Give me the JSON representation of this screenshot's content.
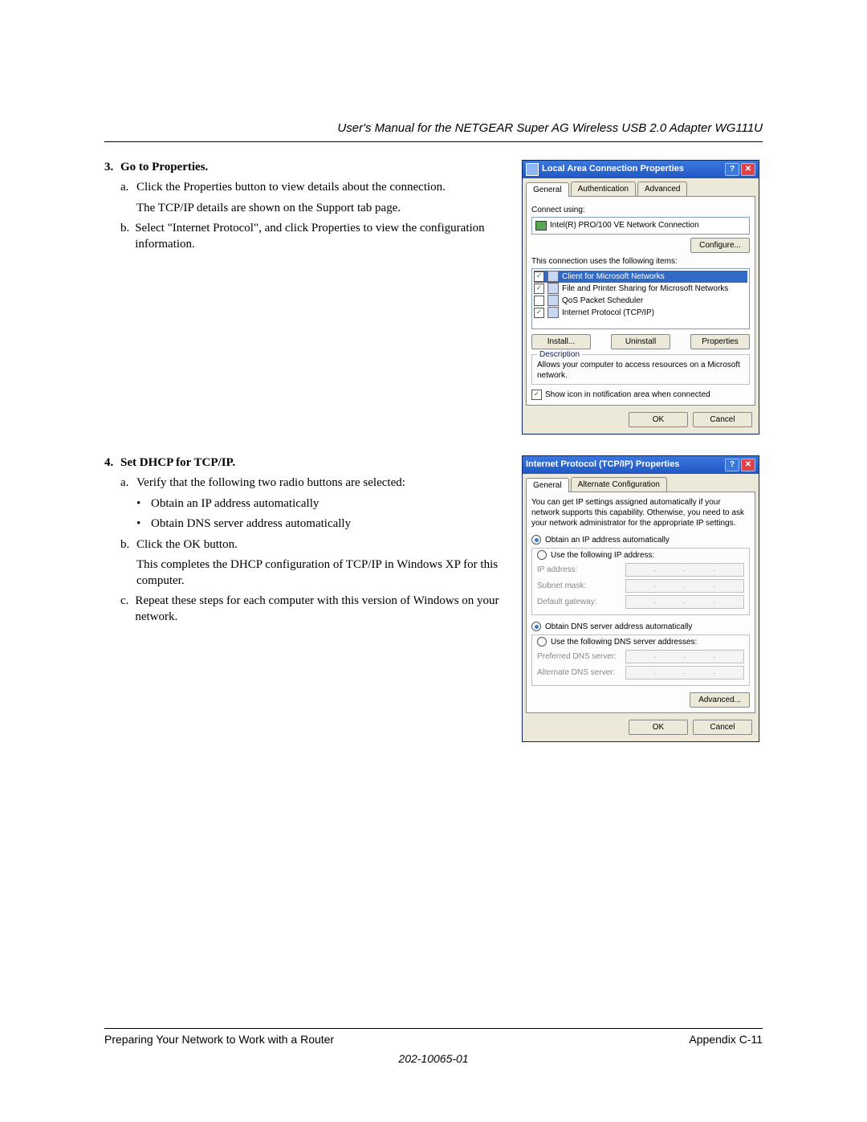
{
  "header": {
    "title": "User's Manual for the NETGEAR Super AG Wireless USB 2.0 Adapter WG111U"
  },
  "step3": {
    "num": "3.",
    "head": "Go to Properties.",
    "a_letter": "a.",
    "a_text": "Click the Properties button to view details about the connection.",
    "a_cont": "The TCP/IP details are shown on the Support tab page.",
    "b_letter": "b.",
    "b_text": "Select \"Internet Protocol\", and click Properties to view the configuration information."
  },
  "step4": {
    "num": "4.",
    "head": "Set DHCP for TCP/IP.",
    "a_letter": "a.",
    "a_text": "Verify that the following two radio buttons are selected:",
    "bullet1": "Obtain an IP address automatically",
    "bullet2": "Obtain DNS server address automatically",
    "b_letter": "b.",
    "b_text": "Click the OK button.",
    "b_cont": "This completes the DHCP configuration of TCP/IP in Windows XP for this computer.",
    "c_letter": "c.",
    "c_text": "Repeat these steps for each computer with this version of Windows on your network."
  },
  "dlg1": {
    "title": "Local Area Connection Properties",
    "tab_general": "General",
    "tab_auth": "Authentication",
    "tab_adv": "Advanced",
    "connect_using": "Connect using:",
    "nic": "Intel(R) PRO/100 VE Network Connection",
    "configure": "Configure...",
    "uses_items": "This connection uses the following items:",
    "item1": "Client for Microsoft Networks",
    "item2": "File and Printer Sharing for Microsoft Networks",
    "item3": "QoS Packet Scheduler",
    "item4": "Internet Protocol (TCP/IP)",
    "install": "Install...",
    "uninstall": "Uninstall",
    "properties": "Properties",
    "desc_head": "Description",
    "desc_text": "Allows your computer to access resources on a Microsoft network.",
    "show_icon": "Show icon in notification area when connected",
    "ok": "OK",
    "cancel": "Cancel"
  },
  "dlg2": {
    "title": "Internet Protocol (TCP/IP) Properties",
    "tab_general": "General",
    "tab_alt": "Alternate Configuration",
    "explain": "You can get IP settings assigned automatically if your network supports this capability. Otherwise, you need to ask your network administrator for the appropriate IP settings.",
    "r_ip_auto": "Obtain an IP address automatically",
    "r_ip_manual": "Use the following IP address:",
    "ip_addr": "IP address:",
    "subnet": "Subnet mask:",
    "gateway": "Default gateway:",
    "r_dns_auto": "Obtain DNS server address automatically",
    "r_dns_manual": "Use the following DNS server addresses:",
    "pref_dns": "Preferred DNS server:",
    "alt_dns": "Alternate DNS server:",
    "advanced": "Advanced...",
    "ok": "OK",
    "cancel": "Cancel"
  },
  "footer": {
    "left": "Preparing Your Network to Work with a Router",
    "right": "Appendix C-11",
    "docnum": "202-10065-01"
  }
}
